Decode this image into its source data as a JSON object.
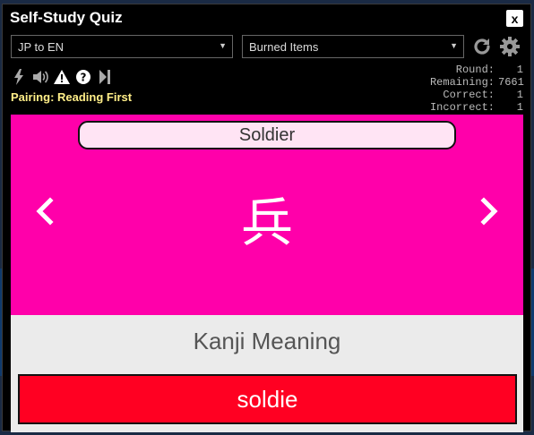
{
  "window": {
    "title": "Self-Study Quiz",
    "close_label": "x"
  },
  "toolbar": {
    "mode_select": "JP to EN",
    "items_select": "Burned Items",
    "refresh_icon": "refresh-icon",
    "settings_icon": "gear-icon"
  },
  "status": {
    "icons": [
      "lightning-icon",
      "speaker-icon",
      "warning-icon",
      "help-icon",
      "skip-icon"
    ],
    "pairing": "Pairing: Reading First"
  },
  "stats": {
    "round_label": "Round:",
    "round": "1",
    "remaining_label": "Remaining:",
    "remaining": "7661",
    "correct_label": "Correct:",
    "correct": "1",
    "incorrect_label": "Incorrect:",
    "incorrect": "1"
  },
  "card": {
    "hint": "Soldier",
    "kanji": "兵",
    "prev_icon": "chevron-left-icon",
    "next_icon": "chevron-right-icon"
  },
  "question": {
    "type": "Kanji Meaning"
  },
  "answer": {
    "value": "soldie"
  },
  "colors": {
    "card_bg": "#ff00aa",
    "answer_bg": "#ff0022",
    "pairing_text": "#ffee88"
  }
}
